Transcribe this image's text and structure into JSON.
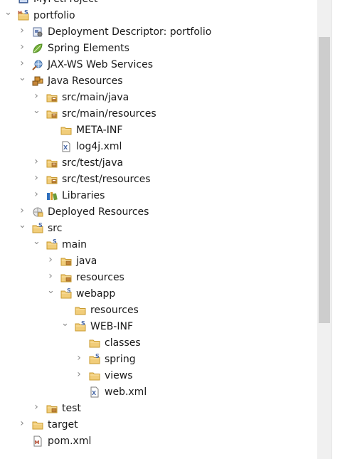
{
  "colors": {
    "folder_fill": "#f1cd7a",
    "folder_stroke": "#c99a2f",
    "java_badge": "#4a6aa8",
    "spring_leaf": "#77b13c",
    "twisty": "#8a8a8a"
  },
  "tree": [
    {
      "level": 0,
      "twisty": "none",
      "icon": "project-icon",
      "label": "MyPetProject"
    },
    {
      "level": 0,
      "twisty": "expanded",
      "icon": "maven-project-icon",
      "label": "portfolio"
    },
    {
      "level": 1,
      "twisty": "collapsed",
      "icon": "deployment-descriptor-icon",
      "label": "Deployment Descriptor: portfolio"
    },
    {
      "level": 1,
      "twisty": "collapsed",
      "icon": "spring-leaf-icon",
      "label": "Spring Elements"
    },
    {
      "level": 1,
      "twisty": "collapsed",
      "icon": "web-services-icon",
      "label": "JAX-WS Web Services"
    },
    {
      "level": 1,
      "twisty": "expanded",
      "icon": "java-resources-icon",
      "label": "Java Resources"
    },
    {
      "level": 2,
      "twisty": "collapsed",
      "icon": "source-folder-icon",
      "label": "src/main/java"
    },
    {
      "level": 2,
      "twisty": "expanded",
      "icon": "source-folder-icon",
      "label": "src/main/resources"
    },
    {
      "level": 3,
      "twisty": "none",
      "icon": "folder-icon",
      "label": "META-INF"
    },
    {
      "level": 3,
      "twisty": "none",
      "icon": "xml-file-icon",
      "label": "log4j.xml"
    },
    {
      "level": 2,
      "twisty": "collapsed",
      "icon": "source-folder-icon",
      "label": "src/test/java"
    },
    {
      "level": 2,
      "twisty": "collapsed",
      "icon": "source-folder-icon",
      "label": "src/test/resources"
    },
    {
      "level": 2,
      "twisty": "collapsed",
      "icon": "libraries-icon",
      "label": "Libraries"
    },
    {
      "level": 1,
      "twisty": "collapsed",
      "icon": "deployed-resources-icon",
      "label": "Deployed Resources"
    },
    {
      "level": 1,
      "twisty": "expanded",
      "icon": "spring-folder-icon",
      "label": "src"
    },
    {
      "level": 2,
      "twisty": "expanded",
      "icon": "spring-folder-icon",
      "label": "main"
    },
    {
      "level": 3,
      "twisty": "collapsed",
      "icon": "package-folder-icon",
      "label": "java"
    },
    {
      "level": 3,
      "twisty": "collapsed",
      "icon": "package-folder-icon",
      "label": "resources"
    },
    {
      "level": 3,
      "twisty": "expanded",
      "icon": "spring-folder-icon",
      "label": "webapp"
    },
    {
      "level": 4,
      "twisty": "none",
      "icon": "folder-icon",
      "label": "resources"
    },
    {
      "level": 4,
      "twisty": "expanded",
      "icon": "spring-folder-icon",
      "label": "WEB-INF"
    },
    {
      "level": 5,
      "twisty": "none",
      "icon": "folder-icon",
      "label": "classes"
    },
    {
      "level": 5,
      "twisty": "collapsed",
      "icon": "spring-folder-icon",
      "label": "spring"
    },
    {
      "level": 5,
      "twisty": "collapsed",
      "icon": "folder-icon",
      "label": "views"
    },
    {
      "level": 5,
      "twisty": "none",
      "icon": "xml-file-icon",
      "label": "web.xml"
    },
    {
      "level": 2,
      "twisty": "collapsed",
      "icon": "package-folder-icon",
      "label": "test"
    },
    {
      "level": 1,
      "twisty": "collapsed",
      "icon": "folder-icon",
      "label": "target"
    },
    {
      "level": 1,
      "twisty": "none",
      "icon": "maven-pom-icon",
      "label": "pom.xml"
    }
  ]
}
